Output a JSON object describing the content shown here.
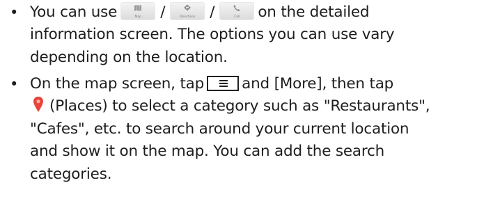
{
  "bullet_char": "•",
  "item1": {
    "l1_a": "You can use",
    "map_button": {
      "label": "Map",
      "icon": "map-icon"
    },
    "slash": "/",
    "directions_button": {
      "label": "Directions",
      "icon": "directions-icon"
    },
    "call_button": {
      "label": "Call",
      "icon": "phone-icon"
    },
    "l1_b": "on the detailed",
    "l2": "information screen. The options you can use vary",
    "l3": "depending on the location."
  },
  "item2": {
    "l1_a": "On the map screen, tap",
    "menu_icon": "menu-key-icon",
    "l1_b": "and [More], then tap",
    "places_icon": "map-pin-icon",
    "l2": "(Places) to select a category such as \"Restaurants\",",
    "l3": "\"Cafes\", etc. to search around your current location",
    "l4": "and show it on the map. You can add the search",
    "l5": "categories.",
    "pin_color": "#e8443a"
  }
}
